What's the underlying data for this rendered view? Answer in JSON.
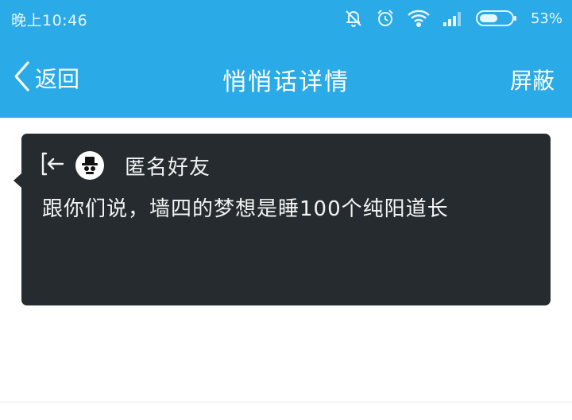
{
  "status_bar": {
    "time": "晚上10:46",
    "battery_percent": "53%",
    "icons": [
      "bell-off-icon",
      "alarm-icon",
      "wifi-icon",
      "signal-icon",
      "battery-icon"
    ]
  },
  "nav": {
    "back_label": "返回",
    "title": "悄悄话详情",
    "block_label": "屏蔽"
  },
  "card": {
    "sender_name": "匿名好友",
    "message": "跟你们说，墙四的梦想是睡100个纯阳道长"
  },
  "colors": {
    "header_bg": "#2aaae6",
    "card_bg": "#252b2f",
    "page_bg": "#ffffff"
  }
}
